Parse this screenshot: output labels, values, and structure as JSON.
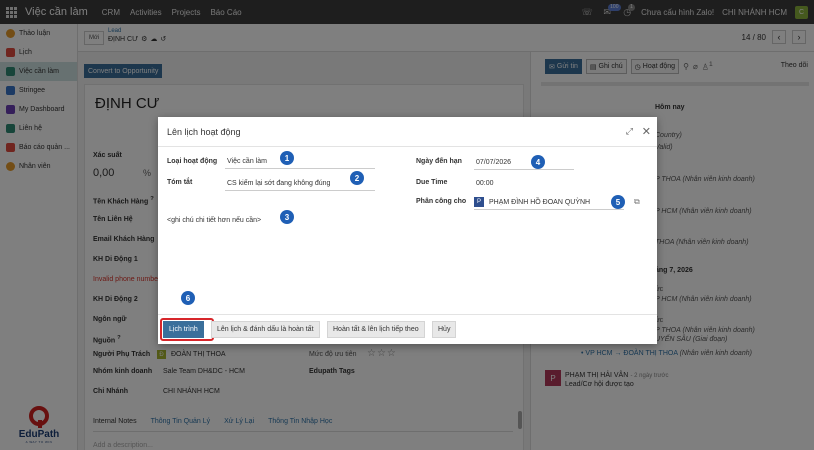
{
  "topbar": {
    "app_title": "Việc cần làm",
    "nav": [
      "CRM",
      "Activities",
      "Projects",
      "Báo Cáo"
    ],
    "badge_messages": "100",
    "badge_activities": "1",
    "zalo_status": "Chưa cấu hình Zalo!",
    "branch": "CHI NHÁNH HCM",
    "user_initial": "C"
  },
  "sidebar": {
    "items": [
      {
        "label": "Thảo luận",
        "color": "#e69b2b"
      },
      {
        "label": "Lịch",
        "color": "#e04b3f"
      },
      {
        "label": "Việc cần làm",
        "color": "#2e8b74"
      },
      {
        "label": "Stringee",
        "color": "#3874c8"
      },
      {
        "label": "My Dashboard",
        "color": "#6a3fb5"
      },
      {
        "label": "Liên hệ",
        "color": "#2e8b74"
      },
      {
        "label": "Báo cáo quản ...",
        "color": "#e04b3f"
      },
      {
        "label": "Nhân viên",
        "color": "#e69b2b"
      }
    ],
    "logo_name": "EduPath",
    "logo_tagline": "A WAY TO WIN"
  },
  "control": {
    "new_label": "Mới",
    "record_type": "Lead",
    "record_name": "ĐỊNH CƯ",
    "pager": "14 / 80"
  },
  "form": {
    "convert_label": "Convert to Opportunity",
    "lead_name": "ĐỊNH CƯ",
    "prob_label": "Xác suất",
    "prob_value": "0,00",
    "prob_pct": "%",
    "labels": {
      "customer_name": "Tên Khách Hàng",
      "contact_name": "Tên Liên Hệ",
      "email": "Email Khách Hàng",
      "phone1": "KH Di Động 1",
      "phone2": "KH Di Động 2",
      "language": "Ngôn ngữ",
      "source": "Nguồn",
      "salesperson": "Người Phụ Trách",
      "sales_team": "Nhóm kinh doanh",
      "branch": "Chi Nhánh",
      "priority": "Mức độ ưu tiên",
      "tags": "Edupath Tags"
    },
    "required_mark": "?",
    "invalid_phone": "Invalid phone number",
    "salesperson_value": "ĐOÀN THỊ THOA",
    "salesperson_initial": "Đ",
    "sales_team_value": "Sale Team DH&DC - HCM",
    "branch_value": "CHI NHÁNH HCM",
    "stars": "☆☆☆",
    "tabs": [
      "Internal Notes",
      "Thông Tin Quản Lý",
      "Xử Lý Lại",
      "Thông Tin Nhập Học"
    ],
    "desc_placeholder": "Add a description..."
  },
  "chatter": {
    "send_label": "Gửi tin",
    "note_label": "Ghi chú",
    "activity_label": "Hoạt động",
    "follow_label": "Theo dõi",
    "attach_count": "1",
    "today": "Hôm nay",
    "country": "Country)",
    "valid": "Valid)",
    "entries": [
      {
        "name": "P THOA",
        "role": "(Nhân viên kinh doanh)"
      },
      {
        "name": "P HCM",
        "role": "(Nhân viên kinh doanh)"
      },
      {
        "name": "THOA",
        "role": "(Nhân viên kinh doanh)"
      },
      {
        "name": "P HCM",
        "role": "(Nhân viên kinh doanh)"
      },
      {
        "name": "P THOA",
        "role": "(Nhân viên kinh doanh)"
      }
    ],
    "date_sep": "áng 7, 2026",
    "dat_chuc": "ức",
    "dat_chuc2": "ức",
    "stage_name": "UYẾN SÂU",
    "stage_role": "(Giai đoạn)",
    "line_from": "VP HCM",
    "line_to": "ĐOÀN THỊ THOA",
    "line_role": "(Nhân viên kinh doanh)",
    "msg_initial": "P",
    "msg_author": "PHẠM THỊ HẢI VÂN",
    "msg_time": "- 2 ngày trước",
    "msg_body": "Lead/Cơ hội được tạo"
  },
  "dialog": {
    "title": "Lên lịch hoạt động",
    "activity_type_label": "Loại hoạt động",
    "activity_type_value": "Việc cần làm",
    "summary_label": "Tóm tắt",
    "summary_value": "CS kiểm lại sớt đang không đúng",
    "due_date_label": "Ngày đến hạn",
    "due_date_value": "07/07/2026",
    "due_time_label": "Due Time",
    "due_time_value": "00:00",
    "assigned_label": "Phân công cho",
    "assigned_initial": "P",
    "assigned_value": "PHẠM ĐÌNH HỒ ĐOAN QUỲNH",
    "note_placeholder": "<ghi chú chi tiết hơn nếu cần>",
    "buttons": {
      "schedule": "Lịch trình",
      "schedule_done": "Lên lịch & đánh dấu là hoàn tất",
      "done_next": "Hoàn tất & lên lịch tiếp theo",
      "cancel": "Hủy"
    }
  },
  "callouts": [
    "1",
    "2",
    "3",
    "4",
    "5",
    "6"
  ]
}
